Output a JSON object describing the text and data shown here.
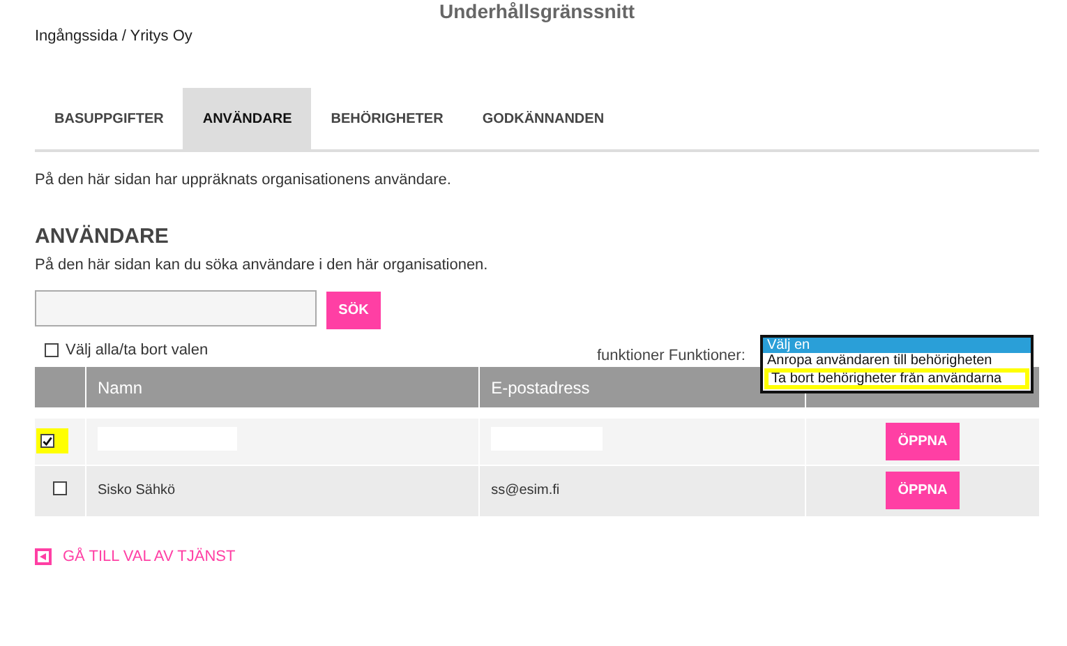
{
  "page_title": "Underhållsgränssnitt",
  "breadcrumb": "Ingångssida / Yritys Oy",
  "tabs": [
    {
      "label": "BASUPPGIFTER",
      "selected": false
    },
    {
      "label": "ANVÄNDARE",
      "selected": true
    },
    {
      "label": "BEHÖRIGHETER",
      "selected": false
    },
    {
      "label": "GODKÄNNANDEN",
      "selected": false
    }
  ],
  "intro": "På den här sidan har uppräknats organisationens användare.",
  "section": {
    "heading": "ANVÄNDARE",
    "description": "På den här sidan kan du söka användare i den här organisationen."
  },
  "search": {
    "button": "SÖK"
  },
  "select_all": {
    "label": "Välj alla/ta bort valen",
    "checked": false
  },
  "functions": {
    "label": "funktioner Funktioner:",
    "options": [
      {
        "label": "Välj en",
        "selected": true,
        "highlighted": false
      },
      {
        "label": "Anropa användaren till behörigheten",
        "selected": false,
        "highlighted": false
      },
      {
        "label": "Ta bort behörigheter från användarna",
        "selected": false,
        "highlighted": true
      }
    ]
  },
  "table": {
    "columns": [
      "",
      "Namn",
      "E-postadress",
      ""
    ],
    "rows": [
      {
        "checked": true,
        "highlighted": true,
        "redacted": true,
        "name": "",
        "email": "",
        "action": "ÖPPNA"
      },
      {
        "checked": false,
        "highlighted": false,
        "redacted": false,
        "name": "Sisko Sähkö",
        "email": "ss@esim.fi",
        "action": "ÖPPNA"
      }
    ]
  },
  "back_link": "GÅ TILL VAL AV TJÄNST"
}
